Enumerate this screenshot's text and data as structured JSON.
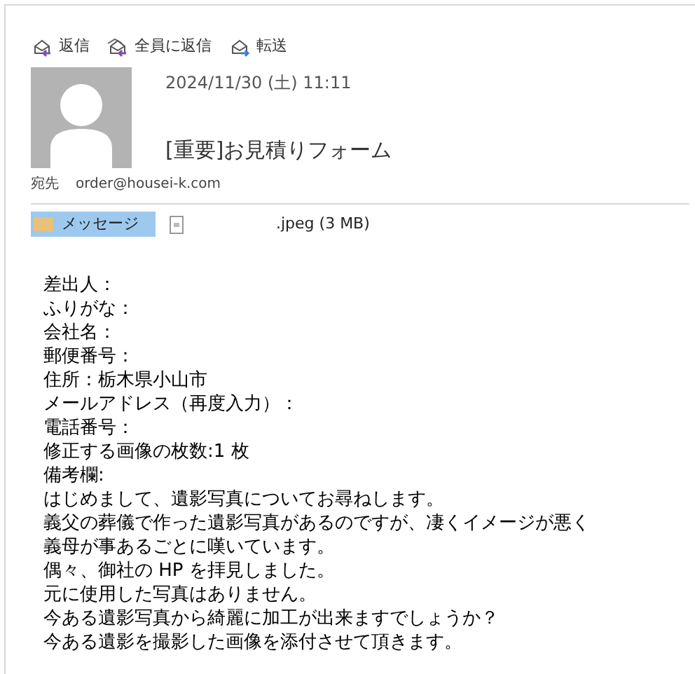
{
  "actions": [
    {
      "kind": "reply",
      "label": "返信"
    },
    {
      "kind": "reply-all",
      "label": "全員に返信"
    },
    {
      "kind": "forward",
      "label": "転送"
    }
  ],
  "header": {
    "date": "2024/11/30 (土) 11:11",
    "subject": "[重要]お見積りフォーム",
    "to_label": "宛先",
    "to": "order@housei-k.com"
  },
  "attachments": [
    {
      "kind": "message",
      "label": "メッセージ",
      "selected": true
    },
    {
      "kind": "file",
      "label": ".jpeg (3 MB)",
      "selected": false
    }
  ],
  "body": [
    "差出人：",
    "ふりがな：",
    "会社名：",
    "郵便番号：",
    "住所：栃木県小山市",
    "メールアドレス（再度入力）：",
    "電話番号：",
    "修正する画像の枚数:1 枚",
    "備考欄:",
    "はじめまして、遺影写真についてお尋ねします。",
    "義父の葬儀で作った遺影写真があるのですが、凄くイメージが悪く",
    "義母が事あるごとに嘆いています。",
    "偶々、御社の HP を拝見しました。",
    "元に使用した写真はありません。",
    "今ある遺影写真から綺麗に加工が出来ますでしょうか？",
    "今ある遺影を撮影した画像を添付させて頂きます。"
  ]
}
